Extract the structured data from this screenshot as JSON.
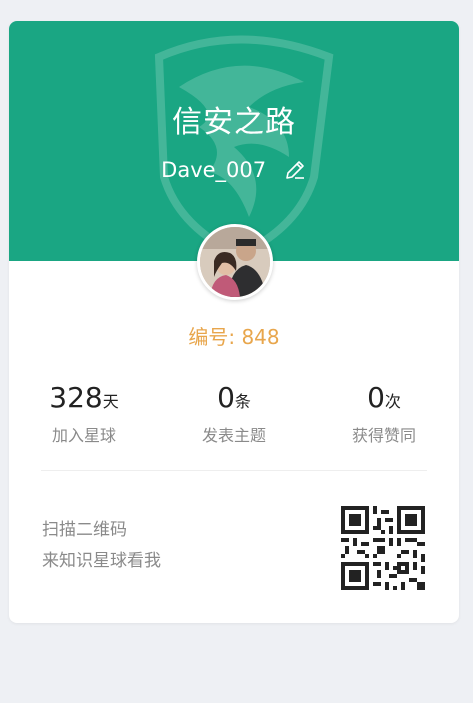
{
  "header": {
    "title": "信安之路",
    "username": "Dave_007",
    "edit_icon": "pencil-edit-icon",
    "background_color": "#1aa683",
    "watermark_icon": "dragon-shield-logo"
  },
  "profile": {
    "avatar_icon": "user-avatar",
    "member_number_label": "编号: 848",
    "accent_color": "#e8a64c"
  },
  "stats": [
    {
      "value": "328",
      "unit": "天",
      "label": "加入星球"
    },
    {
      "value": "0",
      "unit": "条",
      "label": "发表主题"
    },
    {
      "value": "0",
      "unit": "次",
      "label": "获得赞同"
    }
  ],
  "footer": {
    "scan_line1": "扫描二维码",
    "scan_line2": "来知识星球看我",
    "qr_icon": "qr-code-icon"
  }
}
